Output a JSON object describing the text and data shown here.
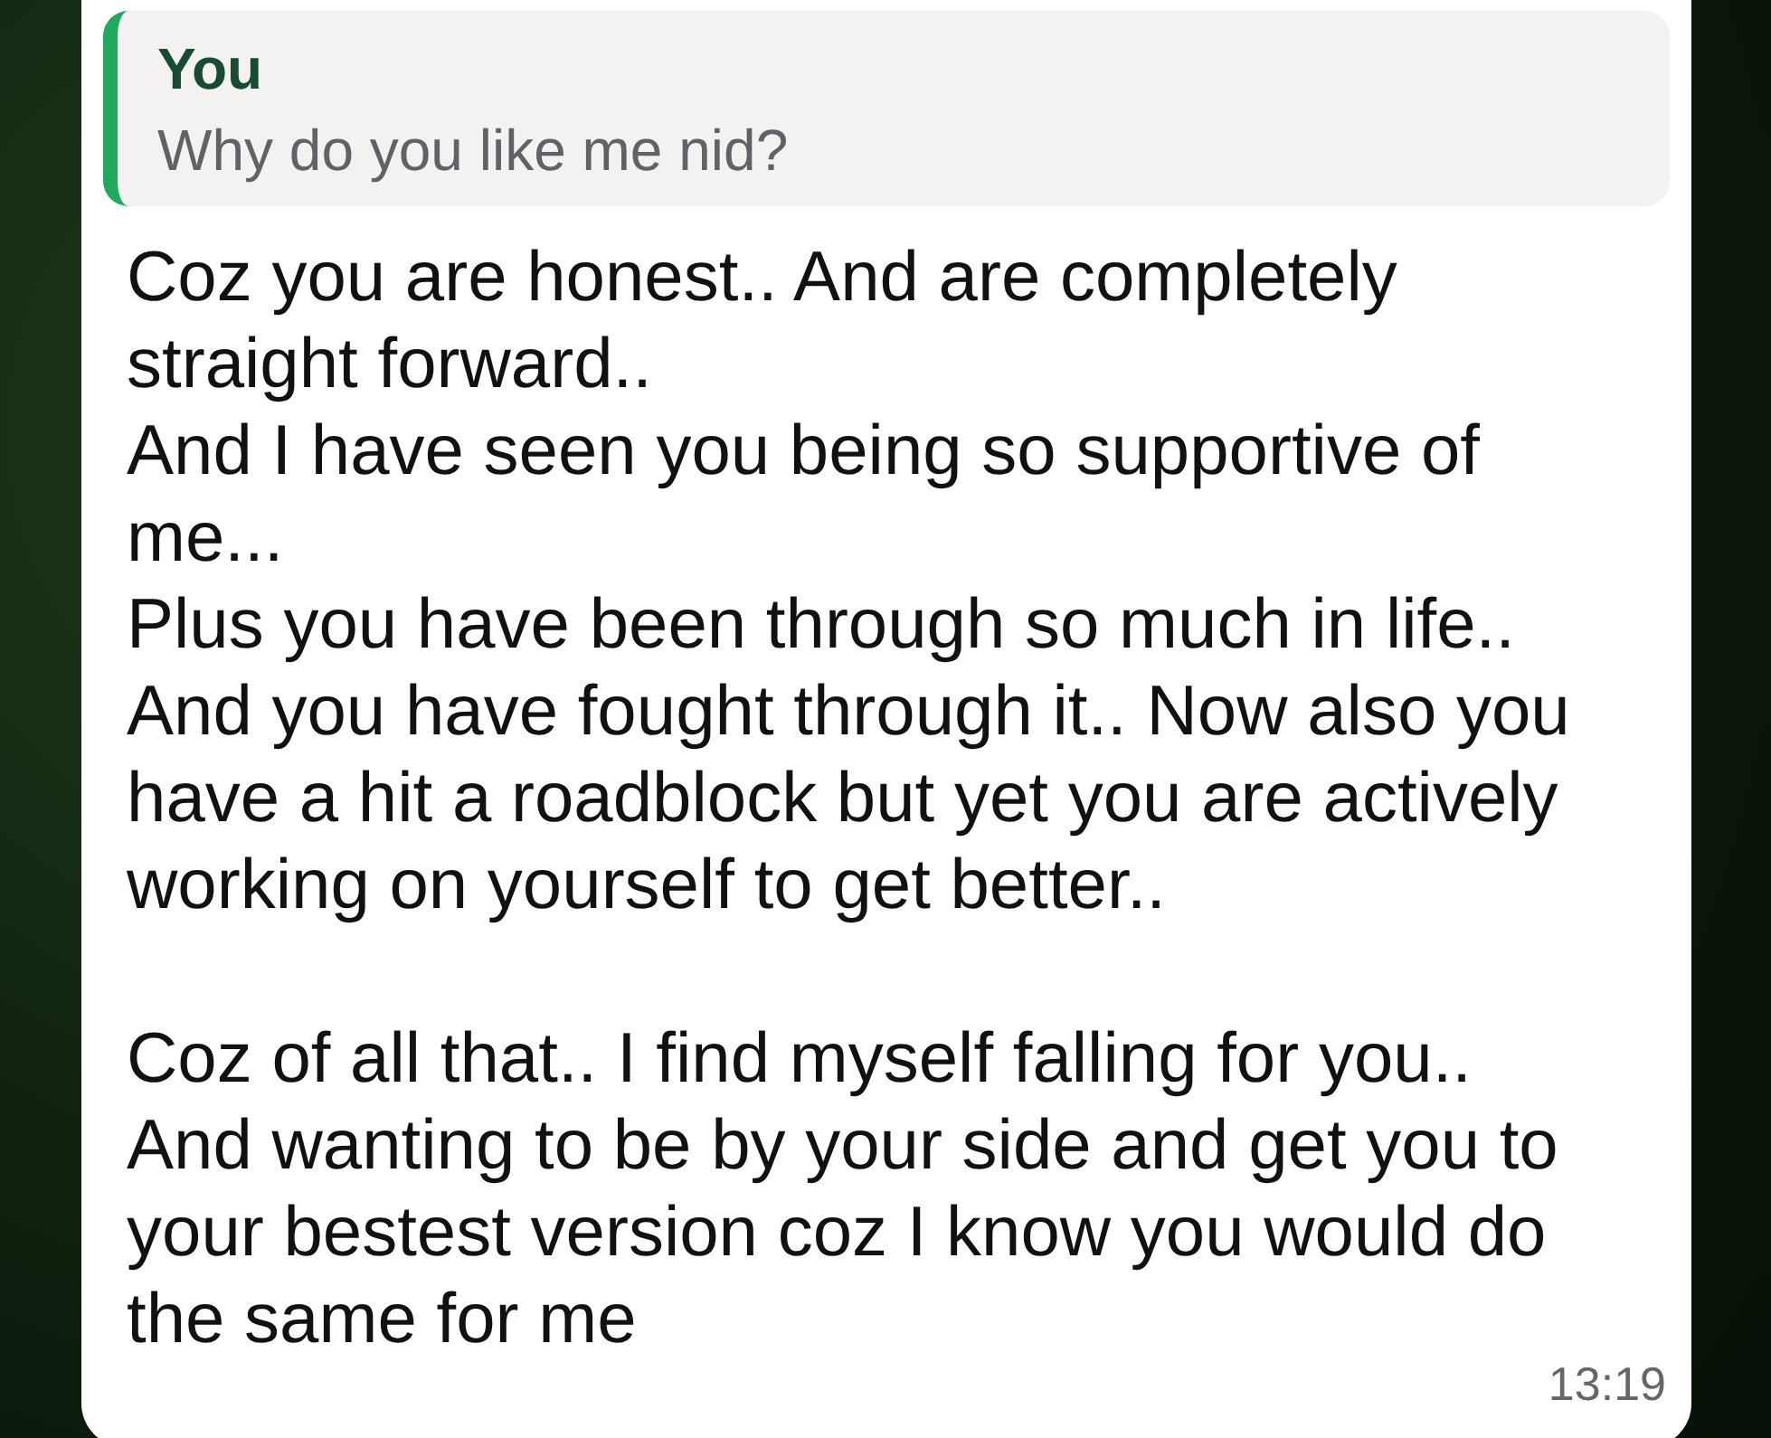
{
  "message": {
    "quote": {
      "author": "You",
      "text": "Why do you like me nid?"
    },
    "text": "Coz you are honest.. And are completely straight forward..\nAnd I have seen you being so supportive of me...\nPlus you have been through so much in life..\nAnd you have fought through it.. Now also you have a hit a roadblock but yet you are actively working on yourself to get better..\n\nCoz of all that.. I find myself falling for you..\nAnd wanting to be by your side and get you to your bestest version coz I know you would do the same for me",
    "time": "13:19"
  }
}
